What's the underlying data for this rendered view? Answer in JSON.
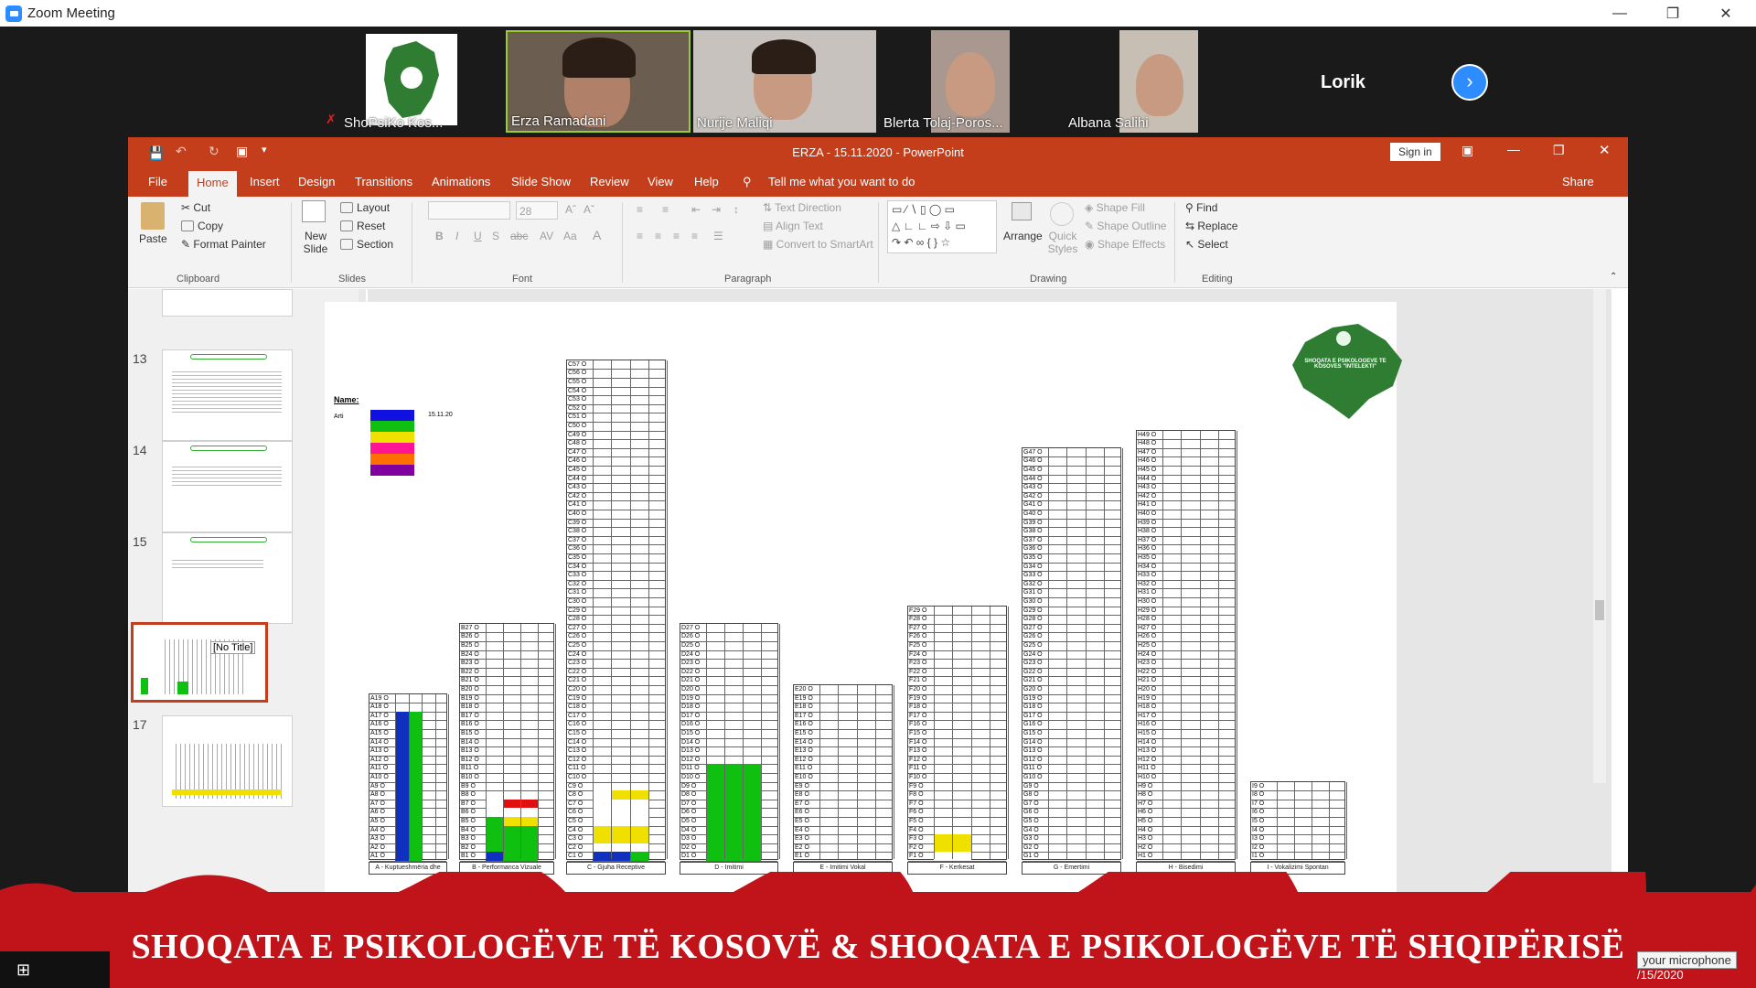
{
  "zoom": {
    "title": "Zoom Meeting"
  },
  "participants": [
    {
      "name": "ShoPsiKo Kos...",
      "muted": true
    },
    {
      "name": "Erza Ramadani"
    },
    {
      "name": "Nurije Maliqi"
    },
    {
      "name": "Blerta Tolaj-Poros..."
    },
    {
      "name": "Albana Salihi"
    },
    {
      "name": "Lorik"
    }
  ],
  "ppt": {
    "title": "ERZA - 15.11.2020  -  PowerPoint",
    "sign_in": "Sign in",
    "share": "Share",
    "tabs": [
      "File",
      "Home",
      "Insert",
      "Design",
      "Transitions",
      "Animations",
      "Slide Show",
      "Review",
      "View",
      "Help"
    ],
    "tell_me": "Tell me what you want to do",
    "ribbon": {
      "paste": "Paste",
      "cut": "Cut",
      "copy": "Copy",
      "format_painter": "Format Painter",
      "new_slide": "New Slide",
      "layout": "Layout",
      "reset": "Reset",
      "section": "Section",
      "font_size": "28",
      "text_direction": "Text Direction",
      "align_text": "Align Text",
      "convert_smartart": "Convert to SmartArt",
      "arrange": "Arrange",
      "quick_styles": "Quick Styles",
      "shape_fill": "Shape Fill",
      "shape_outline": "Shape Outline",
      "shape_effects": "Shape Effects",
      "find": "Find",
      "replace": "Replace",
      "select": "Select",
      "groups": [
        "Clipboard",
        "Slides",
        "Font",
        "Paragraph",
        "Drawing",
        "Editing"
      ]
    },
    "slides": [
      {
        "num": "13"
      },
      {
        "num": "14"
      },
      {
        "num": "15"
      },
      {
        "num": "16",
        "selected": true,
        "tooltip": "[No Title]"
      },
      {
        "num": "17"
      }
    ],
    "slide": {
      "name_label": "Name:",
      "name_value": "Arti",
      "date": "15.11.20",
      "logo_text": "SHOQATA E PSIKOLOGEVE TE KOSOVES \"INTELEKTI\"",
      "legend_colors": [
        "#1010e0",
        "#10c010",
        "#f0e000",
        "#ff1493",
        "#ff7000",
        "#8000a0"
      ],
      "columns": [
        {
          "letter": "A",
          "count": 19,
          "caption": "A - Kuptueshmëria dhe Ekskluzivitet i",
          "fills": [
            [
              "#1030c0",
              "#10c010"
            ],
            [
              "#1030c0",
              "#10c010"
            ],
            [
              "#1030c0",
              "#10c010"
            ],
            [
              "#1030c0",
              "#10c010"
            ],
            [
              "#1030c0",
              "#10c010"
            ],
            [
              "#1030c0",
              "#10c010"
            ],
            [
              "#1030c0",
              "#10c010"
            ],
            [
              "#1030c0",
              "#10c010"
            ],
            [
              "#1030c0",
              "#10c010"
            ],
            [
              "#1030c0",
              "#10c010"
            ],
            [
              "#1030c0",
              "#10c010"
            ],
            [
              "#1030c0",
              "#10c010"
            ],
            [
              "#1030c0",
              "#10c010"
            ],
            [
              "#1030c0",
              "#10c010"
            ],
            [
              "#1030c0",
              "#10c010"
            ],
            [
              "#1030c0",
              "#10c010"
            ],
            [
              "#1030c0",
              "#10c010"
            ]
          ]
        },
        {
          "letter": "B",
          "count": 27,
          "caption": "B - Performanca Vizuale",
          "fills": [
            [
              "#1030c0",
              "#10c010",
              "#10c010"
            ],
            [
              "#10c010",
              "#10c010",
              "#10c010"
            ],
            [
              "#10c010",
              "#10c010",
              "#10c010"
            ],
            [
              "#10c010",
              "#10c010",
              "#10c010"
            ],
            [
              "#10c010",
              "#f0e000",
              "#f0e000"
            ],
            [
              "#ffffff",
              "#ffffff",
              "#ffffff"
            ],
            [
              "#ffffff",
              "#e01010",
              "#e01010"
            ]
          ]
        },
        {
          "letter": "C",
          "count": 57,
          "caption": "C - Gjuha Receptive",
          "fills": [
            [
              "#1030c0",
              "#1030c0",
              "#10c010"
            ],
            [
              "#ffffff",
              "#ffffff",
              "#ffffff"
            ],
            [
              "#f0e000",
              "#f0e000",
              "#f0e000"
            ],
            [
              "#f0e000",
              "#f0e000",
              "#f0e000"
            ],
            [
              "#ffffff",
              "#ffffff",
              "#ffffff"
            ],
            [
              "#ffffff",
              "#ffffff",
              "#ffffff"
            ],
            [
              "#ffffff",
              "#ffffff",
              "#ffffff"
            ],
            [
              "#ffffff",
              "#f0e000",
              "#f0e000"
            ]
          ]
        },
        {
          "letter": "D",
          "count": 27,
          "caption": "D - Imitimi",
          "fills": [
            [
              "#10c010",
              "#10c010",
              "#10c010"
            ],
            [
              "#10c010",
              "#10c010",
              "#10c010"
            ],
            [
              "#10c010",
              "#10c010",
              "#10c010"
            ],
            [
              "#10c010",
              "#10c010",
              "#10c010"
            ],
            [
              "#10c010",
              "#10c010",
              "#10c010"
            ],
            [
              "#10c010",
              "#10c010",
              "#10c010"
            ],
            [
              "#10c010",
              "#10c010",
              "#10c010"
            ],
            [
              "#10c010",
              "#10c010",
              "#10c010"
            ],
            [
              "#10c010",
              "#10c010",
              "#10c010"
            ],
            [
              "#10c010",
              "#10c010",
              "#10c010"
            ],
            [
              "#10c010",
              "#10c010",
              "#10c010"
            ]
          ]
        },
        {
          "letter": "E",
          "count": 20,
          "caption": "E - Imitimi Vokal",
          "fills": []
        },
        {
          "letter": "F",
          "count": 29,
          "caption": "F - Kerkesat",
          "fills": [
            [
              "#ffffff",
              "#ffffff"
            ],
            [
              "#f0e000",
              "#f0e000"
            ],
            [
              "#f0e000",
              "#f0e000"
            ]
          ]
        },
        {
          "letter": "G",
          "count": 47,
          "caption": "G - Emertimi",
          "fills": []
        },
        {
          "letter": "H",
          "count": 49,
          "caption": "H - Bisedimi",
          "fills": []
        },
        {
          "letter": "I",
          "count": 9,
          "caption": "I - Vokalizimi Spontan",
          "fills": []
        }
      ]
    }
  },
  "banner": {
    "text": "SHOQATA E PSIKOLOGËVE TË KOSOVË & SHOQATA E PSIKOLOGËVE TË SHQIPËRISË",
    "mic_tooltip": "your microphone",
    "date_fragment": "/15/2020"
  }
}
